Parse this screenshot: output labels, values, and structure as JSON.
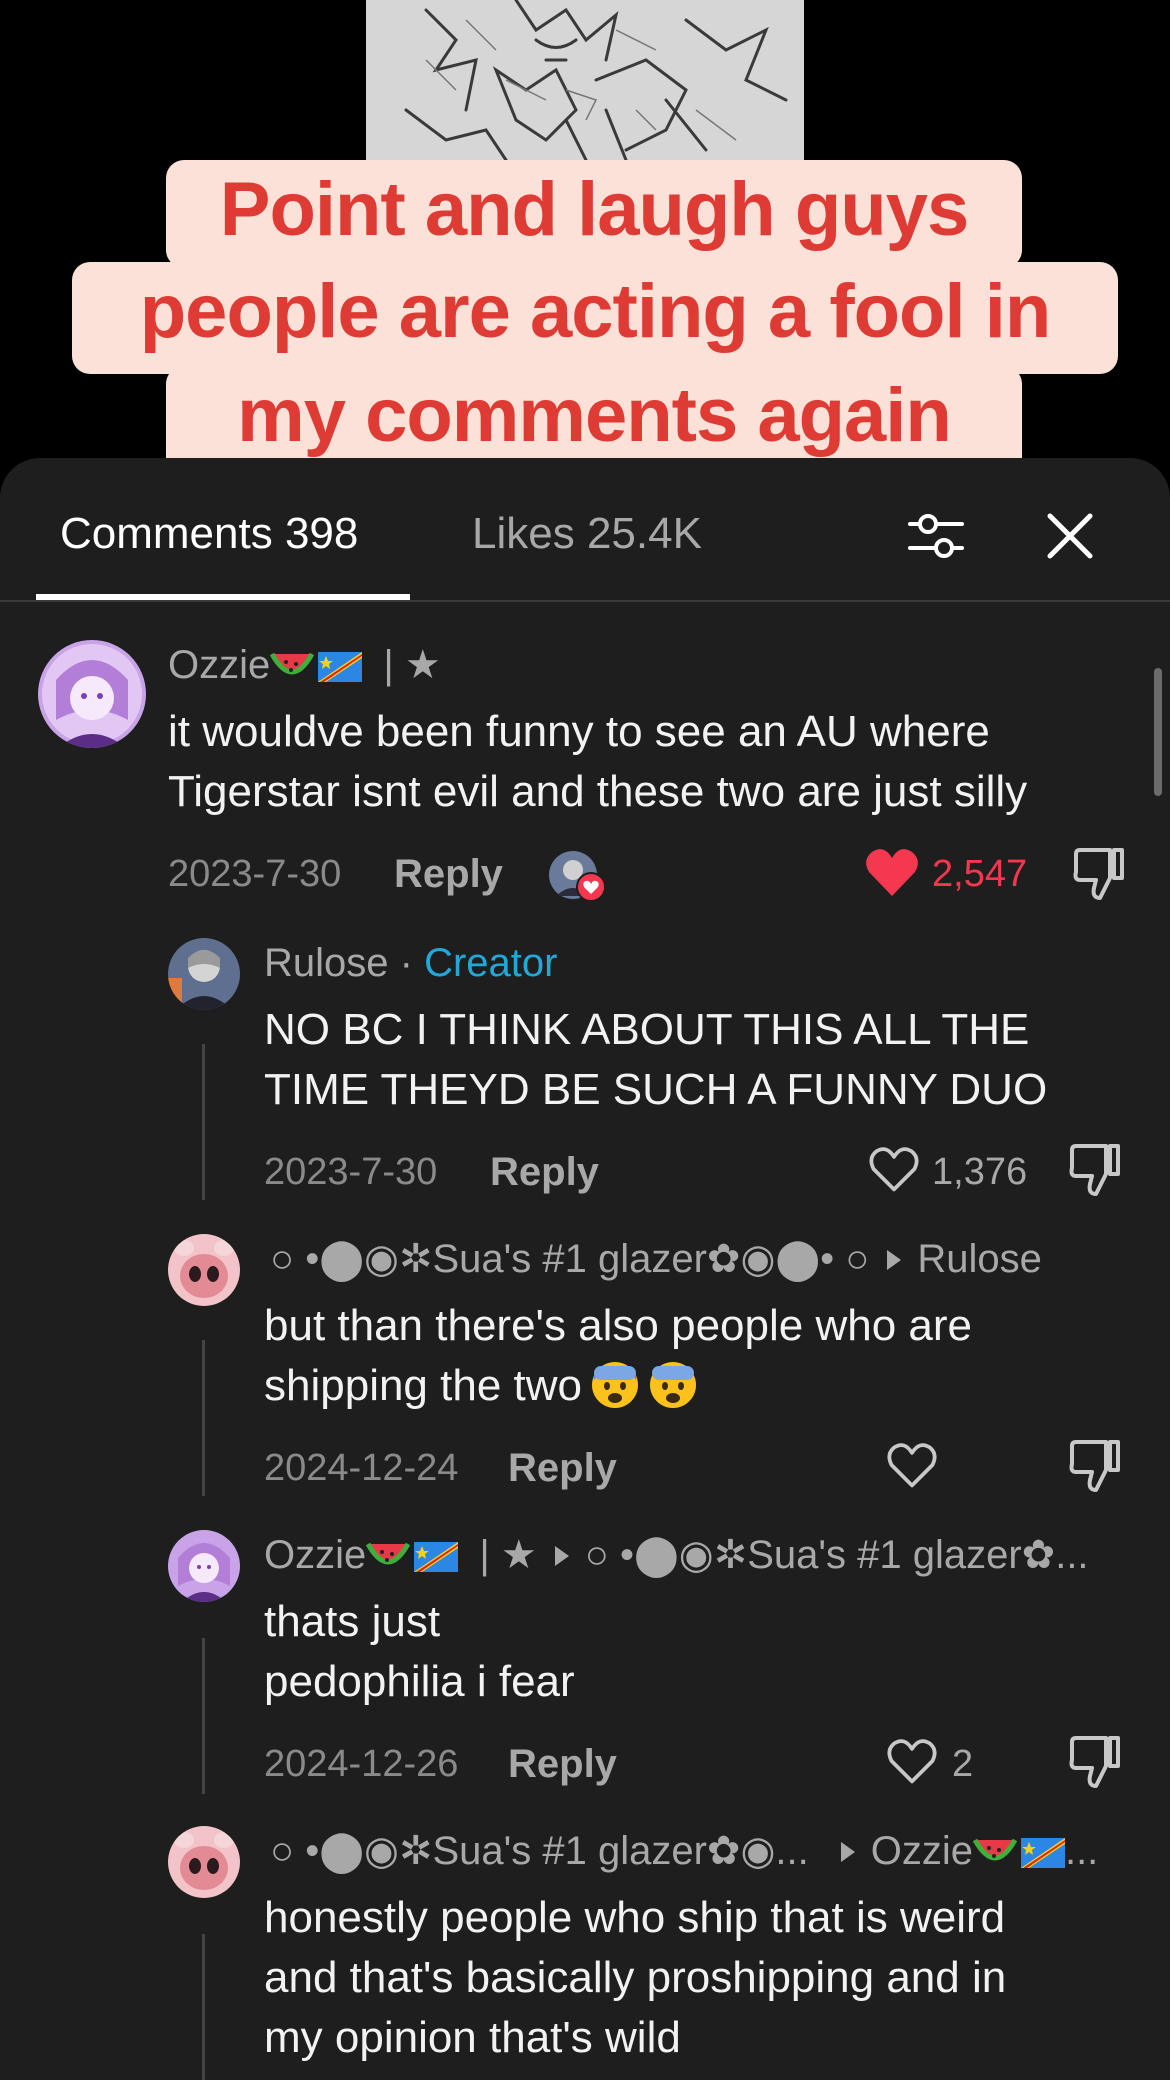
{
  "caption": {
    "line1": "Point and laugh guys",
    "line2": "people are acting a fool in",
    "line3": "my comments again"
  },
  "tabs": {
    "comments": "Comments 398",
    "likes": "Likes 25.4K"
  },
  "icons": {
    "filter": "filter-sliders-icon",
    "close": "close-icon",
    "like": "heart-icon",
    "dislike": "thumbs-down-icon"
  },
  "colors": {
    "panel": "#1e1e1e",
    "like_active": "#f5374f",
    "creator": "#21a8d8",
    "caption_bg": "#fbe1d7",
    "caption_text": "#de3b34"
  },
  "comments": [
    {
      "username": "Ozzie",
      "username_suffix": "| ★",
      "text_line1": "it wouldve been funny to see an AU where",
      "text_line2": "Tigerstar isnt evil and these two are just silly",
      "date": "2023-7-30",
      "reply": "Reply",
      "likes": "2,547",
      "liked": true,
      "creator_liked": true
    },
    {
      "username": "Rulose",
      "separator": "·",
      "badge": "Creator",
      "text_line1": "NO BC I THINK ABOUT THIS ALL THE",
      "text_line2": "TIME THEYD BE SUCH A FUNNY DUO",
      "date": "2023-7-30",
      "reply": "Reply",
      "likes": "1,376"
    },
    {
      "username": "○ •⬤◉✲Sua's #1 glazer✿◉⬤• ○",
      "reply_to": "Rulose",
      "text_line1": "but than there's also people who are",
      "text_line2": "shipping the two",
      "date": "2024-12-24",
      "reply": "Reply",
      "likes": ""
    },
    {
      "username": "Ozzie",
      "username_suffix": "| ★",
      "reply_to": "○ •⬤◉✲Sua's #1 glazer✿...",
      "text_line1": "thats just",
      "text_line2": "pedophilia i fear",
      "date": "2024-12-26",
      "reply": "Reply",
      "likes": "2"
    },
    {
      "username": "○ •⬤◉✲Sua's #1 glazer✿◉...",
      "reply_to": "Ozzie",
      "reply_to_suffix": "...",
      "text_line1": "honestly people who ship that is weird",
      "text_line2": "and that's basically proshipping and in",
      "text_line3": "my opinion that's wild"
    }
  ]
}
